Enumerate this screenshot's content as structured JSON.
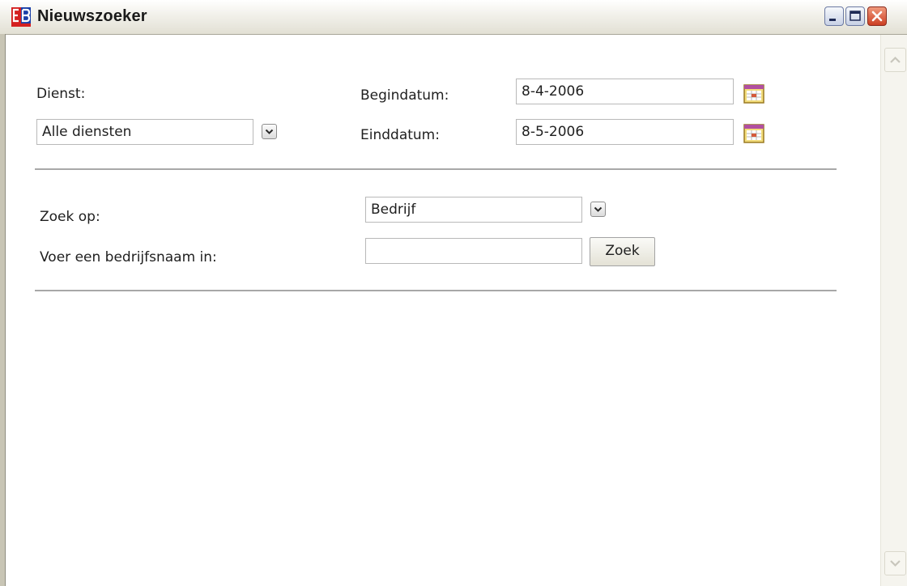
{
  "window": {
    "title": "Nieuwszoeker",
    "icon": "eb-logo-icon",
    "controls": [
      "minimize-icon",
      "maximize-icon",
      "close-icon"
    ]
  },
  "form": {
    "dienst_label": "Dienst:",
    "dienst_select_value": "Alle diensten",
    "begindatum_label": "Begindatum:",
    "begindatum_value": "8-4-2006",
    "einddatum_label": "Einddatum:",
    "einddatum_value": "8-5-2006",
    "zoek_op_label": "Zoek op:",
    "zoek_op_select_value": "Bedrijf",
    "bedrijfsnaam_label": "Voer een bedrijfsnaam in:",
    "bedrijfsnaam_value": "",
    "zoek_button_label": "Zoek"
  },
  "colors": {
    "logo_red": "#d42020",
    "logo_blue": "#1a3fa8",
    "close_red": "#cc3f23",
    "divider": "#a8a8a8"
  }
}
